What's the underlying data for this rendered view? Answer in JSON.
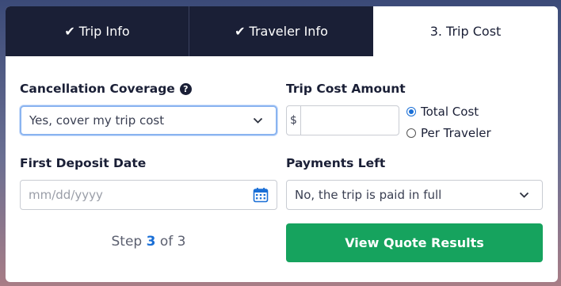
{
  "tabs": [
    {
      "label": "Trip Info",
      "state": "done",
      "icon": "check-icon"
    },
    {
      "label": "Traveler Info",
      "state": "done",
      "icon": "check-icon"
    },
    {
      "label": "3. Trip Cost",
      "state": "active"
    }
  ],
  "form": {
    "coverage": {
      "label": "Cancellation Coverage",
      "help_icon": "?",
      "value": "Yes, cover my trip cost"
    },
    "trip_cost": {
      "label": "Trip Cost Amount",
      "prefix": "$",
      "value": ""
    },
    "cost_basis": {
      "options": [
        {
          "label": "Total Cost",
          "checked": true
        },
        {
          "label": "Per Traveler",
          "checked": false
        }
      ]
    },
    "deposit": {
      "label": "First Deposit Date",
      "placeholder": "mm/dd/yyyy"
    },
    "payments": {
      "label": "Payments Left",
      "value": "No, the trip is paid in full"
    }
  },
  "step": {
    "prefix": "Step",
    "current": "3",
    "middle": "of",
    "total": "3"
  },
  "submit_label": "View Quote Results",
  "colors": {
    "tab_dark": "#1a1f36",
    "accent_blue": "#1a6fd6",
    "button_green": "#16a35e"
  }
}
